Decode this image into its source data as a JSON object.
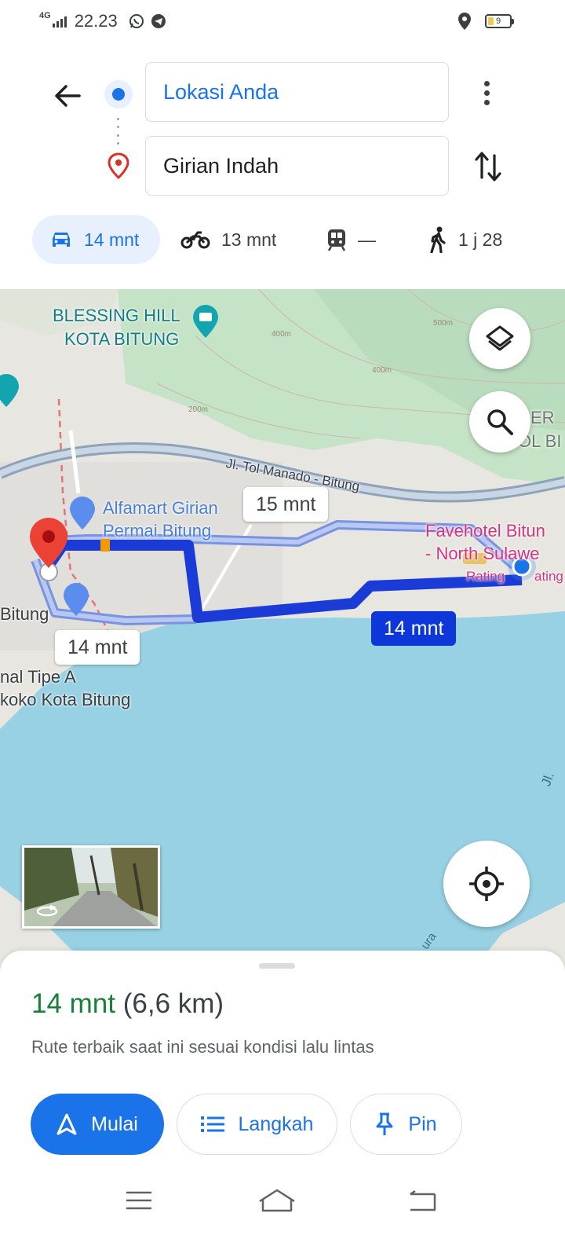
{
  "status_bar": {
    "network": "4G",
    "time": "22.23",
    "battery": "9",
    "icons": [
      "signal-icon",
      "whatsapp-icon",
      "telegram-icon",
      "location-icon",
      "battery-icon"
    ]
  },
  "route": {
    "origin": "Lokasi Anda",
    "destination": "Girian Indah"
  },
  "modes": [
    {
      "icon": "car-icon",
      "label": "14 mnt",
      "active": true
    },
    {
      "icon": "motorcycle-icon",
      "label": "13 mnt",
      "active": false
    },
    {
      "icon": "transit-icon",
      "label": "—",
      "active": false
    },
    {
      "icon": "walk-icon",
      "label": "1 j 28",
      "active": false
    }
  ],
  "map": {
    "labels": {
      "blessing_hill_1": "BLESSING HILL",
      "blessing_hill_2": "KOTA BITUNG",
      "toll_road": "Jl. Tol Manado - Bitung",
      "alfamart_1": "Alfamart Girian",
      "alfamart_2": "Permai Bitung",
      "favehotel_1": "Favehotel Bitun",
      "favehotel_2": "- North Sulawe",
      "favehotel_rating": "Rating",
      "favehotel_rating_2": "ating",
      "bitung": "Bitung",
      "terminal_1": "nal Tipe A",
      "terminal_2": "koko Kota Bitung",
      "partial_top": "ER",
      "partial_top_2": "OL BI",
      "elev_500": "500m",
      "elev_400a": "400m",
      "elev_400b": "400m",
      "elev_200": "200m",
      "edge_1": "Jl.",
      "edge_2": "ura"
    },
    "time_chips": {
      "alt_top": "15 mnt",
      "alt_bottom": "14 mnt",
      "main": "14 mnt"
    },
    "colors": {
      "route_main": "#1a3bd6",
      "route_alt": "#9fb4ee",
      "water": "#97d1e3",
      "park": "#bfdfc2",
      "land": "#e6e3dc",
      "dest_pin": "#ea4335"
    }
  },
  "sheet": {
    "time": "14 mnt",
    "distance": "(6,6 km)",
    "note": "Rute terbaik saat ini sesuai kondisi lalu lintas",
    "buttons": {
      "start": "Mulai",
      "steps": "Langkah",
      "pin": "Pin"
    }
  }
}
